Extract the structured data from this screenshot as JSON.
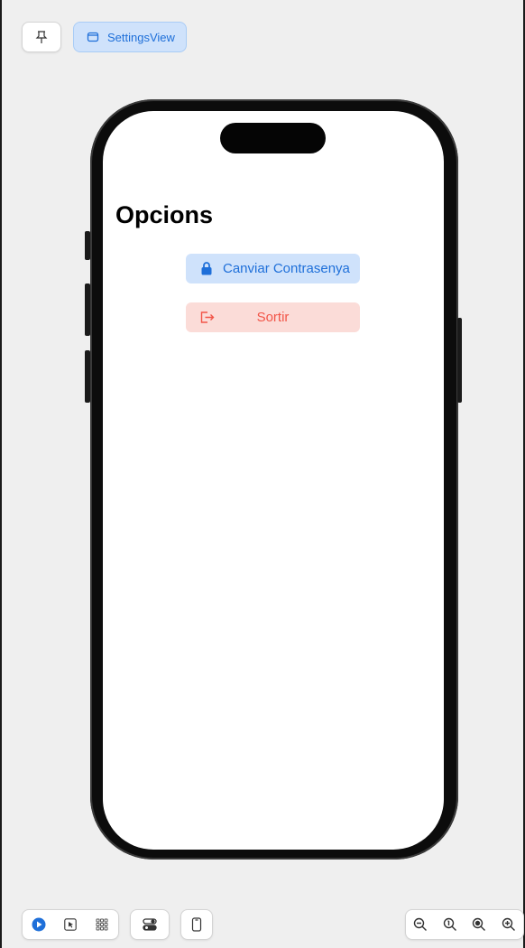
{
  "toolbar_top": {
    "pin_icon": "pin-icon",
    "view_chip_label": "SettingsView",
    "view_chip_icon": "window-icon"
  },
  "screen": {
    "title": "Opcions",
    "change_password_button": {
      "label": "Canviar Contrasenya",
      "icon": "lock-icon"
    },
    "logout_button": {
      "label": "Sortir",
      "icon": "logout-icon"
    }
  },
  "toolbar_bottom": {
    "left_group": [
      "live-preview-icon",
      "selectable-icon",
      "variants-icon"
    ],
    "device_settings": "device-settings-icon",
    "device_icon": "device-icon",
    "zoom": [
      "zoom-out-icon",
      "zoom-fit-icon",
      "zoom-actual-icon",
      "zoom-in-icon"
    ]
  },
  "colors": {
    "accent_blue": "#1e6fd9",
    "blue_bg": "#cfe2fb",
    "danger_red": "#f25548",
    "red_bg": "#fbdcd8"
  }
}
